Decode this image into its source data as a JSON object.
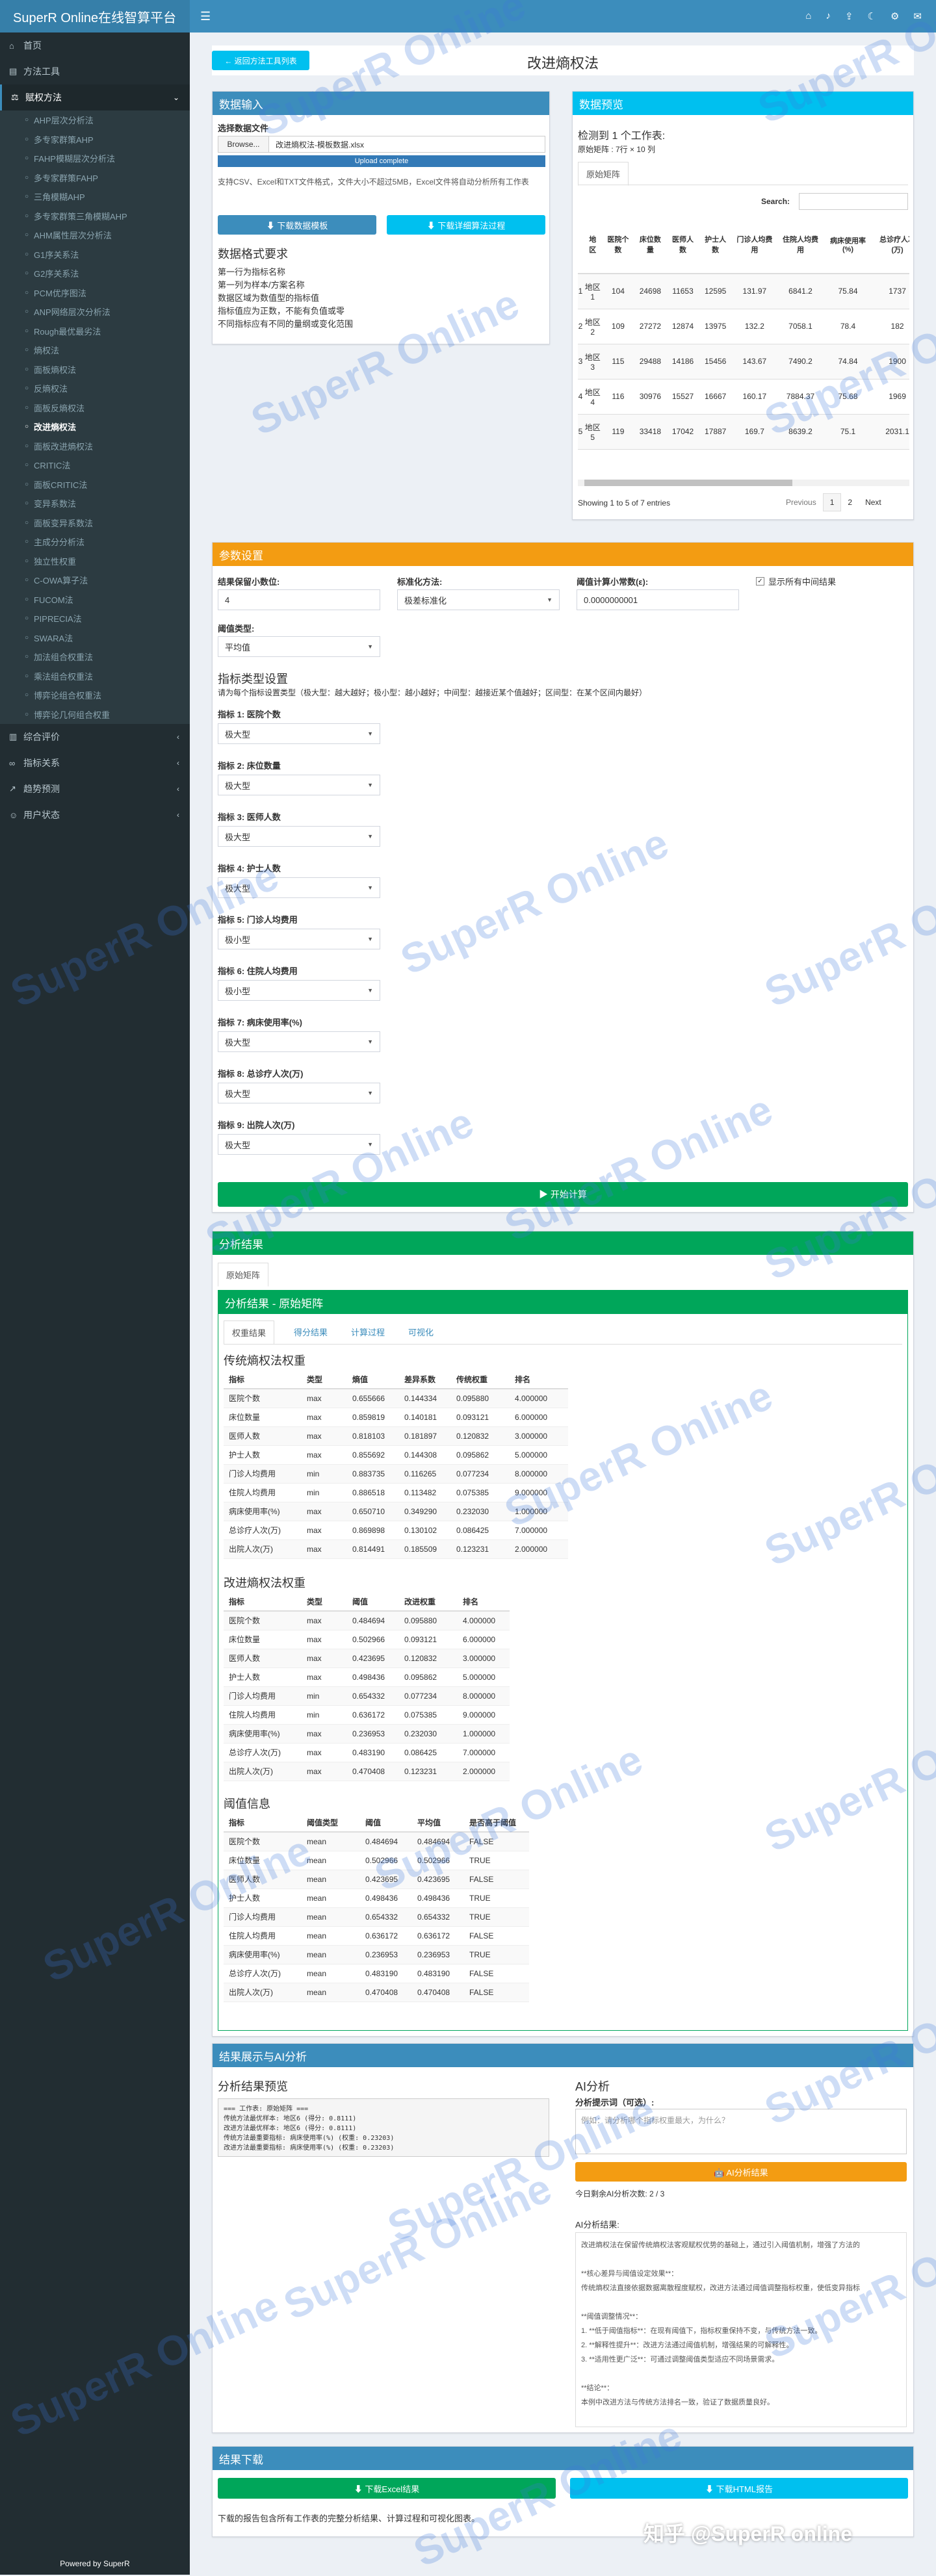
{
  "app": {
    "title": "SuperR Online在线智算平台",
    "powered": "Powered by SuperR"
  },
  "sidebar": {
    "top": [
      {
        "icon": "home-icon",
        "label": "首页"
      },
      {
        "icon": "toolbox-icon",
        "label": "方法工具"
      },
      {
        "icon": "weight-icon",
        "label": "赋权方法"
      }
    ],
    "sub": [
      "AHP层次分析法",
      "多专家群策AHP",
      "FAHP模糊层次分析法",
      "多专家群策FAHP",
      "三角模糊AHP",
      "多专家群策三角模糊AHP",
      "AHM属性层次分析法",
      "G1序关系法",
      "G2序关系法",
      "PCM优序图法",
      "ANP网络层次分析法",
      "Rough最优最劣法",
      "熵权法",
      "面板熵权法",
      "反熵权法",
      "面板反熵权法",
      "改进熵权法",
      "面板改进熵权法",
      "CRITIC法",
      "面板CRITIC法",
      "变异系数法",
      "面板变异系数法",
      "主成分分析法",
      "独立性权重",
      "C-OWA算子法",
      "FUCOM法",
      "PIPRECIA法",
      "SWARA法",
      "加法组合权重法",
      "乘法组合权重法",
      "博弈论组合权重法",
      "博弈论几何组合权重"
    ],
    "bottom": [
      {
        "icon": "chart-icon",
        "label": "综合评价"
      },
      {
        "icon": "link-icon",
        "label": "指标关系"
      },
      {
        "icon": "trend-icon",
        "label": "趋势预测"
      },
      {
        "icon": "user-icon",
        "label": "用户状态"
      }
    ]
  },
  "page": {
    "back": "← 返回方法工具列表",
    "title": "改进熵权法"
  },
  "input": {
    "header": "数据输入",
    "choose_label": "选择数据文件",
    "browse": "Browse...",
    "filename": "改进熵权法-模板数据.xlsx",
    "upload": "Upload complete",
    "note": "支持CSV、Excel和TXT文件格式，文件大小不超过5MB，Excel文件将自动分析所有工作表",
    "dl_template": "⬇ 下载数据模板",
    "dl_tutorial": "⬇ 下载详细算法过程",
    "format_title": "数据格式要求",
    "format_lines": [
      "第一行为指标名称",
      "第一列为样本/方案名称",
      "数据区域为数值型的指标值",
      "指标值应为正数，不能有负值或零",
      "不同指标应有不同的量纲或变化范围"
    ]
  },
  "preview": {
    "header": "数据预览",
    "detected": "检测到 1 个工作表:",
    "dims": "原始矩阵 : 7行 × 10 列",
    "sheet_tab": "原始矩阵",
    "search_label": "Search:",
    "columns": [
      "",
      "地区",
      "医院个数",
      "床位数量",
      "医师人数",
      "护士人数",
      "门诊人均费用",
      "住院人均费用",
      "病床使用率(%)",
      "总诊疗人次(万)"
    ],
    "rows": [
      [
        "1",
        "地区1",
        "104",
        "24698",
        "11653",
        "12595",
        "131.97",
        "6841.2",
        "75.84",
        "1737"
      ],
      [
        "2",
        "地区2",
        "109",
        "27272",
        "12874",
        "13975",
        "132.2",
        "7058.1",
        "78.4",
        "182"
      ],
      [
        "3",
        "地区3",
        "115",
        "29488",
        "14186",
        "15456",
        "143.67",
        "7490.2",
        "74.84",
        "1900"
      ],
      [
        "4",
        "地区4",
        "116",
        "30976",
        "15527",
        "16667",
        "160.17",
        "7884.37",
        "75.68",
        "1969"
      ],
      [
        "5",
        "地区5",
        "119",
        "33418",
        "17042",
        "17887",
        "169.7",
        "8639.2",
        "75.1",
        "2031.1"
      ]
    ],
    "info": "Showing 1 to 5 of 7 entries",
    "prev": "Previous",
    "page1": "1",
    "page2": "2",
    "next": "Next"
  },
  "params": {
    "header": "参数设置",
    "decimal_label": "结果保留小数位:",
    "decimal_val": "4",
    "std_label": "标准化方法:",
    "std_val": "极差标准化",
    "threshold_label": "阈值计算小常数(ε):",
    "threshold_val": "0.0000000001",
    "show_label": "显示所有中间结果",
    "thr_type_label": "阈值类型:",
    "thr_type_val": "平均值",
    "ind_title": "指标类型设置",
    "ind_note": "请为每个指标设置类型（极大型：越大越好；极小型：越小越好；中间型：越接近某个值越好；区间型：在某个区间内最好）",
    "indicators": [
      {
        "label": "指标 1: 医院个数",
        "val": "极大型"
      },
      {
        "label": "指标 2: 床位数量",
        "val": "极大型"
      },
      {
        "label": "指标 3: 医师人数",
        "val": "极大型"
      },
      {
        "label": "指标 4: 护士人数",
        "val": "极大型"
      },
      {
        "label": "指标 5: 门诊人均费用",
        "val": "极小型"
      },
      {
        "label": "指标 6: 住院人均费用",
        "val": "极小型"
      },
      {
        "label": "指标 7: 病床使用率(%)",
        "val": "极大型"
      },
      {
        "label": "指标 8: 总诊疗人次(万)",
        "val": "极大型"
      },
      {
        "label": "指标 9: 出院人次(万)",
        "val": "极大型"
      }
    ],
    "run": "▶ 开始计算"
  },
  "results": {
    "header": "分析结果",
    "sheet_tab": "原始矩阵",
    "sub_header": "分析结果 - 原始矩阵",
    "tabs": [
      "权重结果",
      "得分结果",
      "计算过程",
      "可视化"
    ],
    "t1_title": "传统熵权法权重",
    "t1_cols": [
      "指标",
      "类型",
      "熵值",
      "差异系数",
      "传统权重",
      "排名"
    ],
    "t1": [
      [
        "医院个数",
        "max",
        "0.655666",
        "0.144334",
        "0.095880",
        "4.000000"
      ],
      [
        "床位数量",
        "max",
        "0.859819",
        "0.140181",
        "0.093121",
        "6.000000"
      ],
      [
        "医师人数",
        "max",
        "0.818103",
        "0.181897",
        "0.120832",
        "3.000000"
      ],
      [
        "护士人数",
        "max",
        "0.855692",
        "0.144308",
        "0.095862",
        "5.000000"
      ],
      [
        "门诊人均费用",
        "min",
        "0.883735",
        "0.116265",
        "0.077234",
        "8.000000"
      ],
      [
        "住院人均费用",
        "min",
        "0.886518",
        "0.113482",
        "0.075385",
        "9.000000"
      ],
      [
        "病床使用率(%)",
        "max",
        "0.650710",
        "0.349290",
        "0.232030",
        "1.000000"
      ],
      [
        "总诊疗人次(万)",
        "max",
        "0.869898",
        "0.130102",
        "0.086425",
        "7.000000"
      ],
      [
        "出院人次(万)",
        "max",
        "0.814491",
        "0.185509",
        "0.123231",
        "2.000000"
      ]
    ],
    "t2_title": "改进熵权法权重",
    "t2_cols": [
      "指标",
      "类型",
      "阈值",
      "改进权重",
      "排名"
    ],
    "t2": [
      [
        "医院个数",
        "max",
        "0.484694",
        "0.095880",
        "4.000000"
      ],
      [
        "床位数量",
        "max",
        "0.502966",
        "0.093121",
        "6.000000"
      ],
      [
        "医师人数",
        "max",
        "0.423695",
        "0.120832",
        "3.000000"
      ],
      [
        "护士人数",
        "max",
        "0.498436",
        "0.095862",
        "5.000000"
      ],
      [
        "门诊人均费用",
        "min",
        "0.654332",
        "0.077234",
        "8.000000"
      ],
      [
        "住院人均费用",
        "min",
        "0.636172",
        "0.075385",
        "9.000000"
      ],
      [
        "病床使用率(%)",
        "max",
        "0.236953",
        "0.232030",
        "1.000000"
      ],
      [
        "总诊疗人次(万)",
        "max",
        "0.483190",
        "0.086425",
        "7.000000"
      ],
      [
        "出院人次(万)",
        "max",
        "0.470408",
        "0.123231",
        "2.000000"
      ]
    ],
    "t3_title": "阈值信息",
    "t3_cols": [
      "指标",
      "阈值类型",
      "阈值",
      "平均值",
      "是否高于阈值"
    ],
    "t3": [
      [
        "医院个数",
        "mean",
        "0.484694",
        "0.484694",
        "FALSE"
      ],
      [
        "床位数量",
        "mean",
        "0.502966",
        "0.502966",
        "TRUE"
      ],
      [
        "医师人数",
        "mean",
        "0.423695",
        "0.423695",
        "FALSE"
      ],
      [
        "护士人数",
        "mean",
        "0.498436",
        "0.498436",
        "TRUE"
      ],
      [
        "门诊人均费用",
        "mean",
        "0.654332",
        "0.654332",
        "TRUE"
      ],
      [
        "住院人均费用",
        "mean",
        "0.636172",
        "0.636172",
        "FALSE"
      ],
      [
        "病床使用率(%)",
        "mean",
        "0.236953",
        "0.236953",
        "TRUE"
      ],
      [
        "总诊疗人次(万)",
        "mean",
        "0.483190",
        "0.483190",
        "FALSE"
      ],
      [
        "出院人次(万)",
        "mean",
        "0.470408",
        "0.470408",
        "FALSE"
      ]
    ]
  },
  "ai": {
    "header": "结果展示与AI分析",
    "preview_title": "分析结果预览",
    "preview_lines": [
      "=== 工作表: 原始矩阵 ===",
      "传统方法最优样本: 地区6 (得分: 0.8111)",
      "改进方法最优样本: 地区6 (得分: 0.8111)",
      "传统方法最重要指标: 病床使用率(%) (权重: 0.23203)",
      "改进方法最重要指标: 病床使用率(%) (权重: 0.23203)"
    ],
    "ai_title": "AI分析",
    "prompt_label": "分析提示词（可选）:",
    "prompt_placeholder": "例如：请分析哪个指标权重最大，为什么？",
    "ai_button": "🤖 AI分析结果",
    "remaining": "今日剩余AI分析次数: 2 / 3",
    "result_label": "AI分析结果:",
    "result_lines": [
      "改进熵权法在保留传统熵权法客观赋权优势的基础上，通过引入阈值机制，增强了方法的",
      "",
      "**核心差异与阈值设定效果**：",
      "传统熵权法直接依据数据离散程度赋权，改进方法通过阈值调整指标权重，使低变异指标",
      "",
      "**阈值调整情况**：",
      "1. **低于阈值指标**：在现有阈值下，指标权重保持不变，与传统方法一致。",
      "2. **解释性提升**：改进方法通过阈值机制，增强结果的可解释性。",
      "3. **适用性更广泛**：可通过调整阈值类型适应不同场景需求。",
      "",
      "**结论**：",
      "本例中改进方法与传统方法排名一致，验证了数据质量良好。"
    ]
  },
  "download": {
    "header": "结果下载",
    "excel": "⬇ 下载Excel结果",
    "html": "⬇ 下载HTML报告",
    "note": "下载的报告包含所有工作表的完整分析结果、计算过程和可视化图表。"
  },
  "watermark": "SuperR Online",
  "footer_wm": "知乎 @SuperR online"
}
